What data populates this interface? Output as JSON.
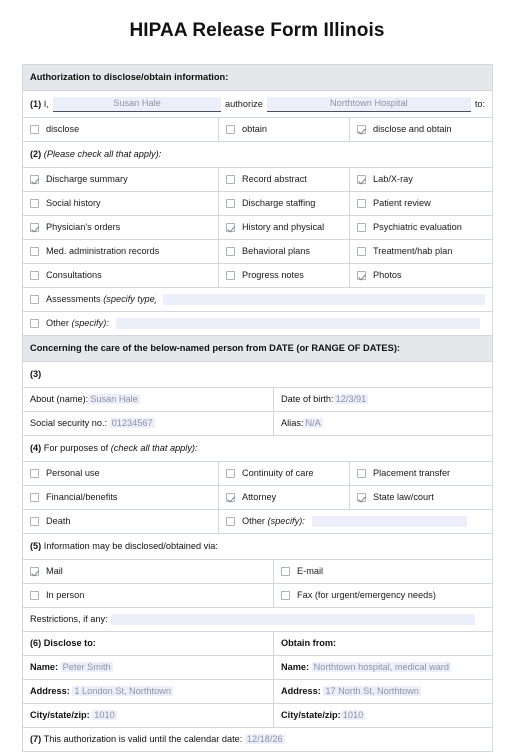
{
  "title": "HIPAA Release Form Illinois",
  "section_auth": {
    "header": "Authorization to disclose/obtain information:",
    "row1": {
      "number": "(1)",
      "lead": "I,",
      "name_value": "Susan Hale",
      "mid": "authorize",
      "org_value": "Northtown Hospital",
      "tail": "to:"
    },
    "options": [
      {
        "label": "disclose",
        "checked": false
      },
      {
        "label": "obtain",
        "checked": false
      },
      {
        "label": "disclose and obtain",
        "checked": true
      }
    ]
  },
  "section_records": {
    "number": "(2)",
    "instruction": "(Please check all that apply):",
    "options": [
      {
        "label": "Discharge summary",
        "checked": true
      },
      {
        "label": "Record abstract",
        "checked": false
      },
      {
        "label": "Lab/X-ray",
        "checked": true
      },
      {
        "label": "Social history",
        "checked": false
      },
      {
        "label": "Discharge staffing",
        "checked": false
      },
      {
        "label": "Patient review",
        "checked": false
      },
      {
        "label": "Physician's orders",
        "checked": true
      },
      {
        "label": "History and physical",
        "checked": true
      },
      {
        "label": "Psychiatric evaluation",
        "checked": false
      },
      {
        "label": "Med. administration records",
        "checked": false
      },
      {
        "label": "Behavioral plans",
        "checked": false
      },
      {
        "label": "Treatment/hab plan",
        "checked": false
      },
      {
        "label": "Consultations",
        "checked": false
      },
      {
        "label": "Progress notes",
        "checked": false
      },
      {
        "label": "Photos",
        "checked": true
      }
    ],
    "assessments": {
      "label": "Assessments",
      "hint": "(specify type):",
      "checked": false,
      "value": ""
    },
    "other": {
      "label": "Other",
      "hint": "(specify):",
      "checked": false,
      "value": ""
    }
  },
  "section_care": {
    "header": "Concerning the care of the below-named person from DATE (or RANGE OF DATES):",
    "number": "(3)",
    "fields": {
      "about_name_label": "About (name):",
      "about_name_value": "Susan Hale",
      "dob_label": "Date of birth:",
      "dob_value": "12/3/91",
      "ssn_label": "Social security no.:",
      "ssn_value": "01234567",
      "alias_label": "Alias:",
      "alias_value": "N/A"
    }
  },
  "section_purposes": {
    "number": "(4)",
    "lead": "For purposes of",
    "instruction": "(check all that apply):",
    "options": [
      {
        "label": "Personal use",
        "checked": false
      },
      {
        "label": "Continuity of care",
        "checked": false
      },
      {
        "label": "Placement transfer",
        "checked": false
      },
      {
        "label": "Financial/benefits",
        "checked": false
      },
      {
        "label": "Attorney",
        "checked": true
      },
      {
        "label": "State law/court",
        "checked": true
      },
      {
        "label": "Death",
        "checked": false
      }
    ],
    "other": {
      "label": "Other",
      "hint": "(specify):",
      "checked": false,
      "value": ""
    }
  },
  "section_via": {
    "header": "Information may be disclosed/obtained via:",
    "number": "(5)",
    "options": [
      {
        "label": "Mail",
        "checked": true
      },
      {
        "label": "E-mail",
        "checked": false
      },
      {
        "label": "In person",
        "checked": false
      },
      {
        "label": "Fax (for urgent/emergency needs)",
        "checked": false
      }
    ],
    "restrictions_label": "Restrictions, if any:",
    "restrictions_value": ""
  },
  "section_parties": {
    "number": "(6)",
    "disclose_to_header": "Disclose to:",
    "obtain_from_header": "Obtain from:",
    "labels": {
      "name": "Name:",
      "address": "Address:",
      "city": "City/state/zip:"
    },
    "disclose_to": {
      "name": "Peter Smith",
      "address": "1 London St, Northtown",
      "city": "1010"
    },
    "obtain_from": {
      "name": "Northtown hospital, medical ward",
      "address": "17 North St, Northtown",
      "city": "1010"
    }
  },
  "section_validity": {
    "number": "(7)",
    "label": "This authorization is valid until the calendar date:",
    "value": "12/18/26"
  },
  "colors": {
    "band_background": "#e6e7ea",
    "field_highlight": "#eceffa",
    "value_text": "#8b93a4",
    "border": "#d2d6de",
    "checkbox_border": "#adb2bd",
    "check_mark": "#7b808c"
  }
}
